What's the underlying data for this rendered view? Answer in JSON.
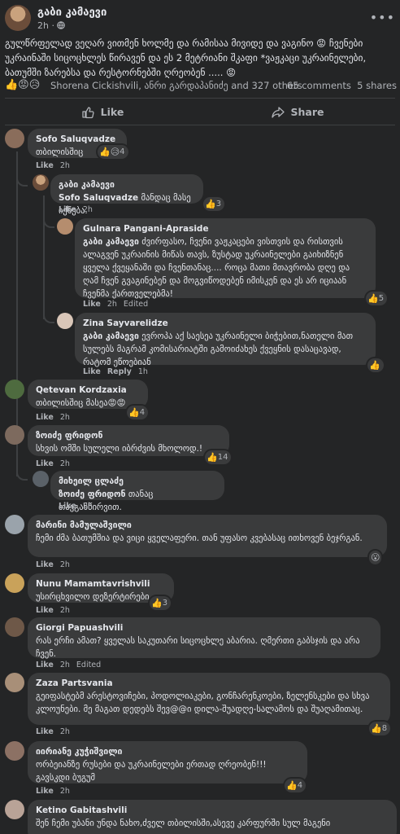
{
  "post": {
    "author": "გაბი კამაევი",
    "time": "2h",
    "privacy_icon": "globe-icon",
    "text": "გულწრფელად ვეღარ ვითმენ ხოლმე და რამისაა მივიდე და ვაგინო 😡 ჩვენები უკრაინაში სიცოცხლეს წირავენ და ეს 2 მეტრიანი შკაფი *ვაჟკაცი უკრაინელები, ბათუმში ზარებსა და რესტორნებში ღრეობენ ..... 😡",
    "reaction_icons": "👍😡😥",
    "reaction_names": "Shorena Cickishvili, ანრი გარდაპანიძე and 327 others",
    "comments_count": "65 comments",
    "shares_count": "5 shares"
  },
  "actions": {
    "like": "Like",
    "share": "Share"
  },
  "labels": {
    "like": "Like",
    "reply": "Reply",
    "edited": "Edited"
  },
  "comments": [
    {
      "author": "Sofo Saluqvadze",
      "text": "თბილისშიც",
      "time": "2h",
      "reactions": "4",
      "reaction_icons": "👍😥"
    },
    {
      "author": "გაბი კამაევი",
      "tag": "Sofo Saluqvadze",
      "text": "მანდაც მასე იქნება.",
      "time": "2h",
      "reactions": "3",
      "reaction_icons": "👍"
    },
    {
      "author": "Gulnara Pangani-Apraside",
      "tag": "გაბი კამაევი",
      "text": "ძვირფასო, ჩვენი ვაჟკაცები ვისთვის და რისთვის ალაგვენ უკრაინის მიწას თავს, ზუსტად უკრაინელები გაიხიზნენ ყველა ქვეყანაში და ჩვენთანაც.... როცა მათი მთავრობა დღე და ღამ ჩვენ გვაგინებენ და მოგვიწოდებენ იმისკენ და ეს არ იციაან ჩვენმა ქართველებმა!",
      "time": "2h",
      "edited": "Edited",
      "reactions": "5",
      "reaction_icons": "👍"
    },
    {
      "author": "Zina Sayvarelidze",
      "tag": "გაბი კამაევი",
      "text": "ევროპა აქ საესეა უკრაინელი ბიჭებით,ნათელი მათ სულებს მაგრამ კომისარიატში გამოიძახეს ქვეყნის დასაცავად, რატომ ეწოებიან",
      "time": "1h",
      "reactions": "",
      "reaction_icons": "👍"
    },
    {
      "author": "Qetevan Kordzaxia",
      "text": "თბილისშიც მასეა😡😡",
      "time": "2h",
      "reactions": "4",
      "reaction_icons": "👍"
    },
    {
      "author": "ზოიძე ფრიდონ",
      "text": "სხვის ომში სულელი იბრძვის მხოლოდ.!",
      "time": "2h",
      "reactions": "14",
      "reaction_icons": "👍"
    },
    {
      "author": "მიხეილ ცლაძე",
      "tag": "ზოიძე ფრიდონ",
      "text": "თანაც თავგანწირვით.",
      "time": "2h",
      "reactions": "",
      "reaction_icons": ""
    },
    {
      "author": "მარინი მამულაშვილი",
      "text": "ჩემი ძმა ბათუმშია და ვიცი ყველაფერი. თან უფასო კვებასაც ითხოვენ ბეჯრგან.",
      "time": "2h",
      "reactions": "",
      "reaction_icons": "😮"
    },
    {
      "author": "Nunu Mamamtavrishvili",
      "text": "უსირცხვილო დეზერტირები",
      "time": "2h",
      "reactions": "3",
      "reaction_icons": "👍"
    },
    {
      "author": "Giorgi Papuashvili",
      "text": "რას ერჩი ამათ? ყველას საკუთარი სიცოცხლე აბარია. ღმერთი გაბსჯის და არა ჩვენ.",
      "time": "2h",
      "edited": "Edited",
      "reactions": "",
      "reaction_icons": ""
    },
    {
      "author": "Zaza Partsvania",
      "text": "გეიფასტებმ არესტოვიჩები, პოდოლიაკები, გონჩარენკოები, ზელენსკები და სხვა კლოუნები. მე მაგათ დედებს შევ@@ი დილა-შუადღე-სალამოს და შუაღამითაც.",
      "time": "2h",
      "reactions": "8",
      "reaction_icons": "👍"
    },
    {
      "author": "იირიანე კუჭიშვილი",
      "text": "ორბეიანზე რუსები და უკრაინელები ერთად ღრეობენ!!! გავსკდი ბუგუმ",
      "time": "2h",
      "reactions": "4",
      "reaction_icons": "👍"
    },
    {
      "author": "Ketino Gabitashvili",
      "text": "შენ ჩემი უბანი უნდა ნახო,ძველ თბილისში,ასევე კარფურში სულ მაგენი",
      "time": "",
      "reactions": "",
      "reaction_icons": ""
    }
  ]
}
